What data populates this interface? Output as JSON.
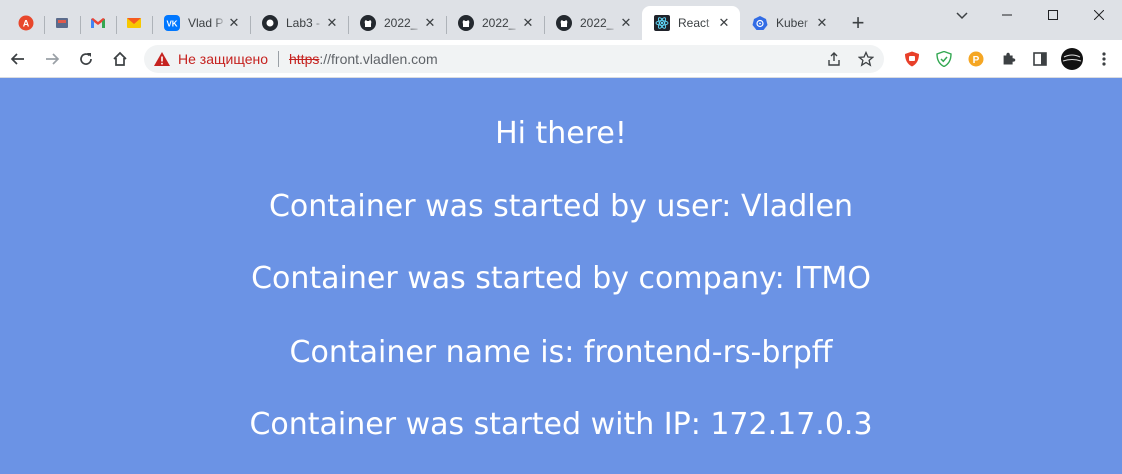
{
  "browser": {
    "tabs": [
      {
        "title": "Vlad P",
        "icon": "vk-icon"
      },
      {
        "title": "Lab3 -",
        "icon": "github-dark-icon"
      },
      {
        "title": "2022_",
        "icon": "github-icon"
      },
      {
        "title": "2022_",
        "icon": "github-icon"
      },
      {
        "title": "2022_",
        "icon": "github-icon"
      },
      {
        "title": "React",
        "icon": "react-icon",
        "active": true
      },
      {
        "title": "Kuber",
        "icon": "kubernetes-icon"
      }
    ],
    "pinned_tabs": [
      "adblock-icon",
      "app-icon",
      "gmail-icon",
      "yandex-mail-icon"
    ],
    "security_text": "Не защищено",
    "url_scheme": "https",
    "url_rest": "://front.vladlen.com",
    "colors": {
      "page_bg": "#6b93e5",
      "warning": "#c5221f"
    }
  },
  "page": {
    "greeting": "Hi there!",
    "user_line": "Container was started by user: Vladlen",
    "company_line": "Container was started by company: ITMO",
    "name_line": "Container name is: frontend-rs-brpff",
    "ip_line": "Container was started with IP: 172.17.0.3"
  }
}
